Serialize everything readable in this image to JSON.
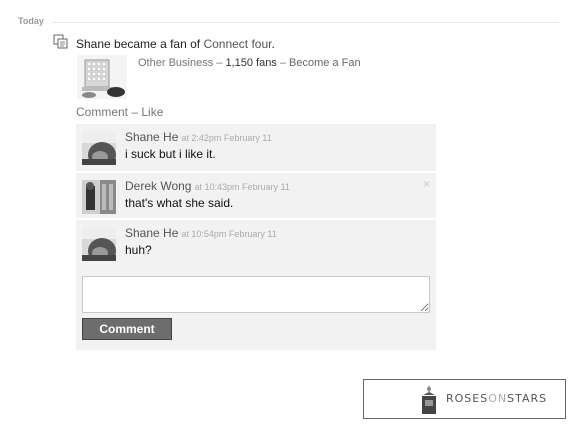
{
  "feed": {
    "day_label": "Today",
    "story": {
      "actor": "Shane",
      "action": " became a fan of ",
      "page_name": "Connect four",
      "end": "."
    },
    "page_meta": {
      "category": "Other Business",
      "sep1": " – ",
      "fans": "1,150 fans",
      "sep2": " – ",
      "become_fan": "Become a Fan"
    },
    "actions": {
      "comment": "Comment",
      "sep": " – ",
      "like": "Like"
    },
    "comments": [
      {
        "author": "Shane He",
        "time": "at 2:42pm February 11",
        "text": "i suck but i like it."
      },
      {
        "author": "Derek Wong",
        "time": "at 10:43pm February 11",
        "text": "that's what she said.",
        "delete_icon": "×"
      },
      {
        "author": "Shane He",
        "time": "at 10:54pm February 11",
        "text": "huh?"
      }
    ],
    "compose": {
      "value": "",
      "submit_label": "Comment"
    }
  },
  "watermark": {
    "part1": "ROSES",
    "part2": "ON",
    "part3": "STARS"
  },
  "colors": {
    "comment_bg": "#f2f2f2",
    "button_bg": "#6d6d6d",
    "link_gray": "#555555"
  }
}
